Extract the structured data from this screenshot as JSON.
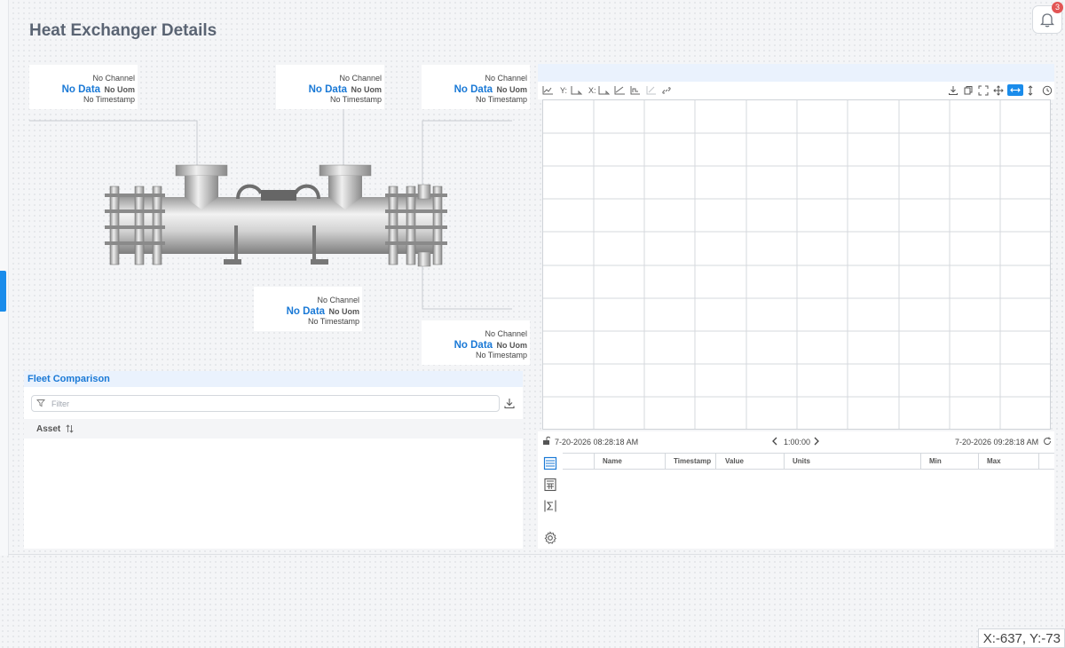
{
  "page": {
    "title": "Heat Exchanger Details"
  },
  "notifications": {
    "count": "3",
    "icon": "bell-icon"
  },
  "callouts": [
    {
      "channel": "No Channel",
      "value": "No Data",
      "uom": "No Uom",
      "timestamp": "No Timestamp"
    },
    {
      "channel": "No Channel",
      "value": "No Data",
      "uom": "No Uom",
      "timestamp": "No Timestamp"
    },
    {
      "channel": "No Channel",
      "value": "No Data",
      "uom": "No Uom",
      "timestamp": "No Timestamp"
    },
    {
      "channel": "No Channel",
      "value": "No Data",
      "uom": "No Uom",
      "timestamp": "No Timestamp"
    },
    {
      "channel": "No Channel",
      "value": "No Data",
      "uom": "No Uom",
      "timestamp": "No Timestamp"
    }
  ],
  "fleet": {
    "title": "Fleet Comparison",
    "filter_placeholder": "Filter",
    "asset_column": "Asset"
  },
  "chart": {
    "y_label": "Y:",
    "x_label": "X:",
    "start_time": "7-20-2026 08:28:18 AM",
    "interval": "1:00:00",
    "end_time": "7-20-2026 09:28:18 AM"
  },
  "table": {
    "columns": [
      "Name",
      "Timestamp",
      "Value",
      "Units",
      "Min",
      "Max"
    ]
  },
  "status": {
    "coords": "X:-637, Y:-73"
  },
  "colors": {
    "accent": "#1a79d6",
    "panel_header": "#eaf2fd"
  }
}
